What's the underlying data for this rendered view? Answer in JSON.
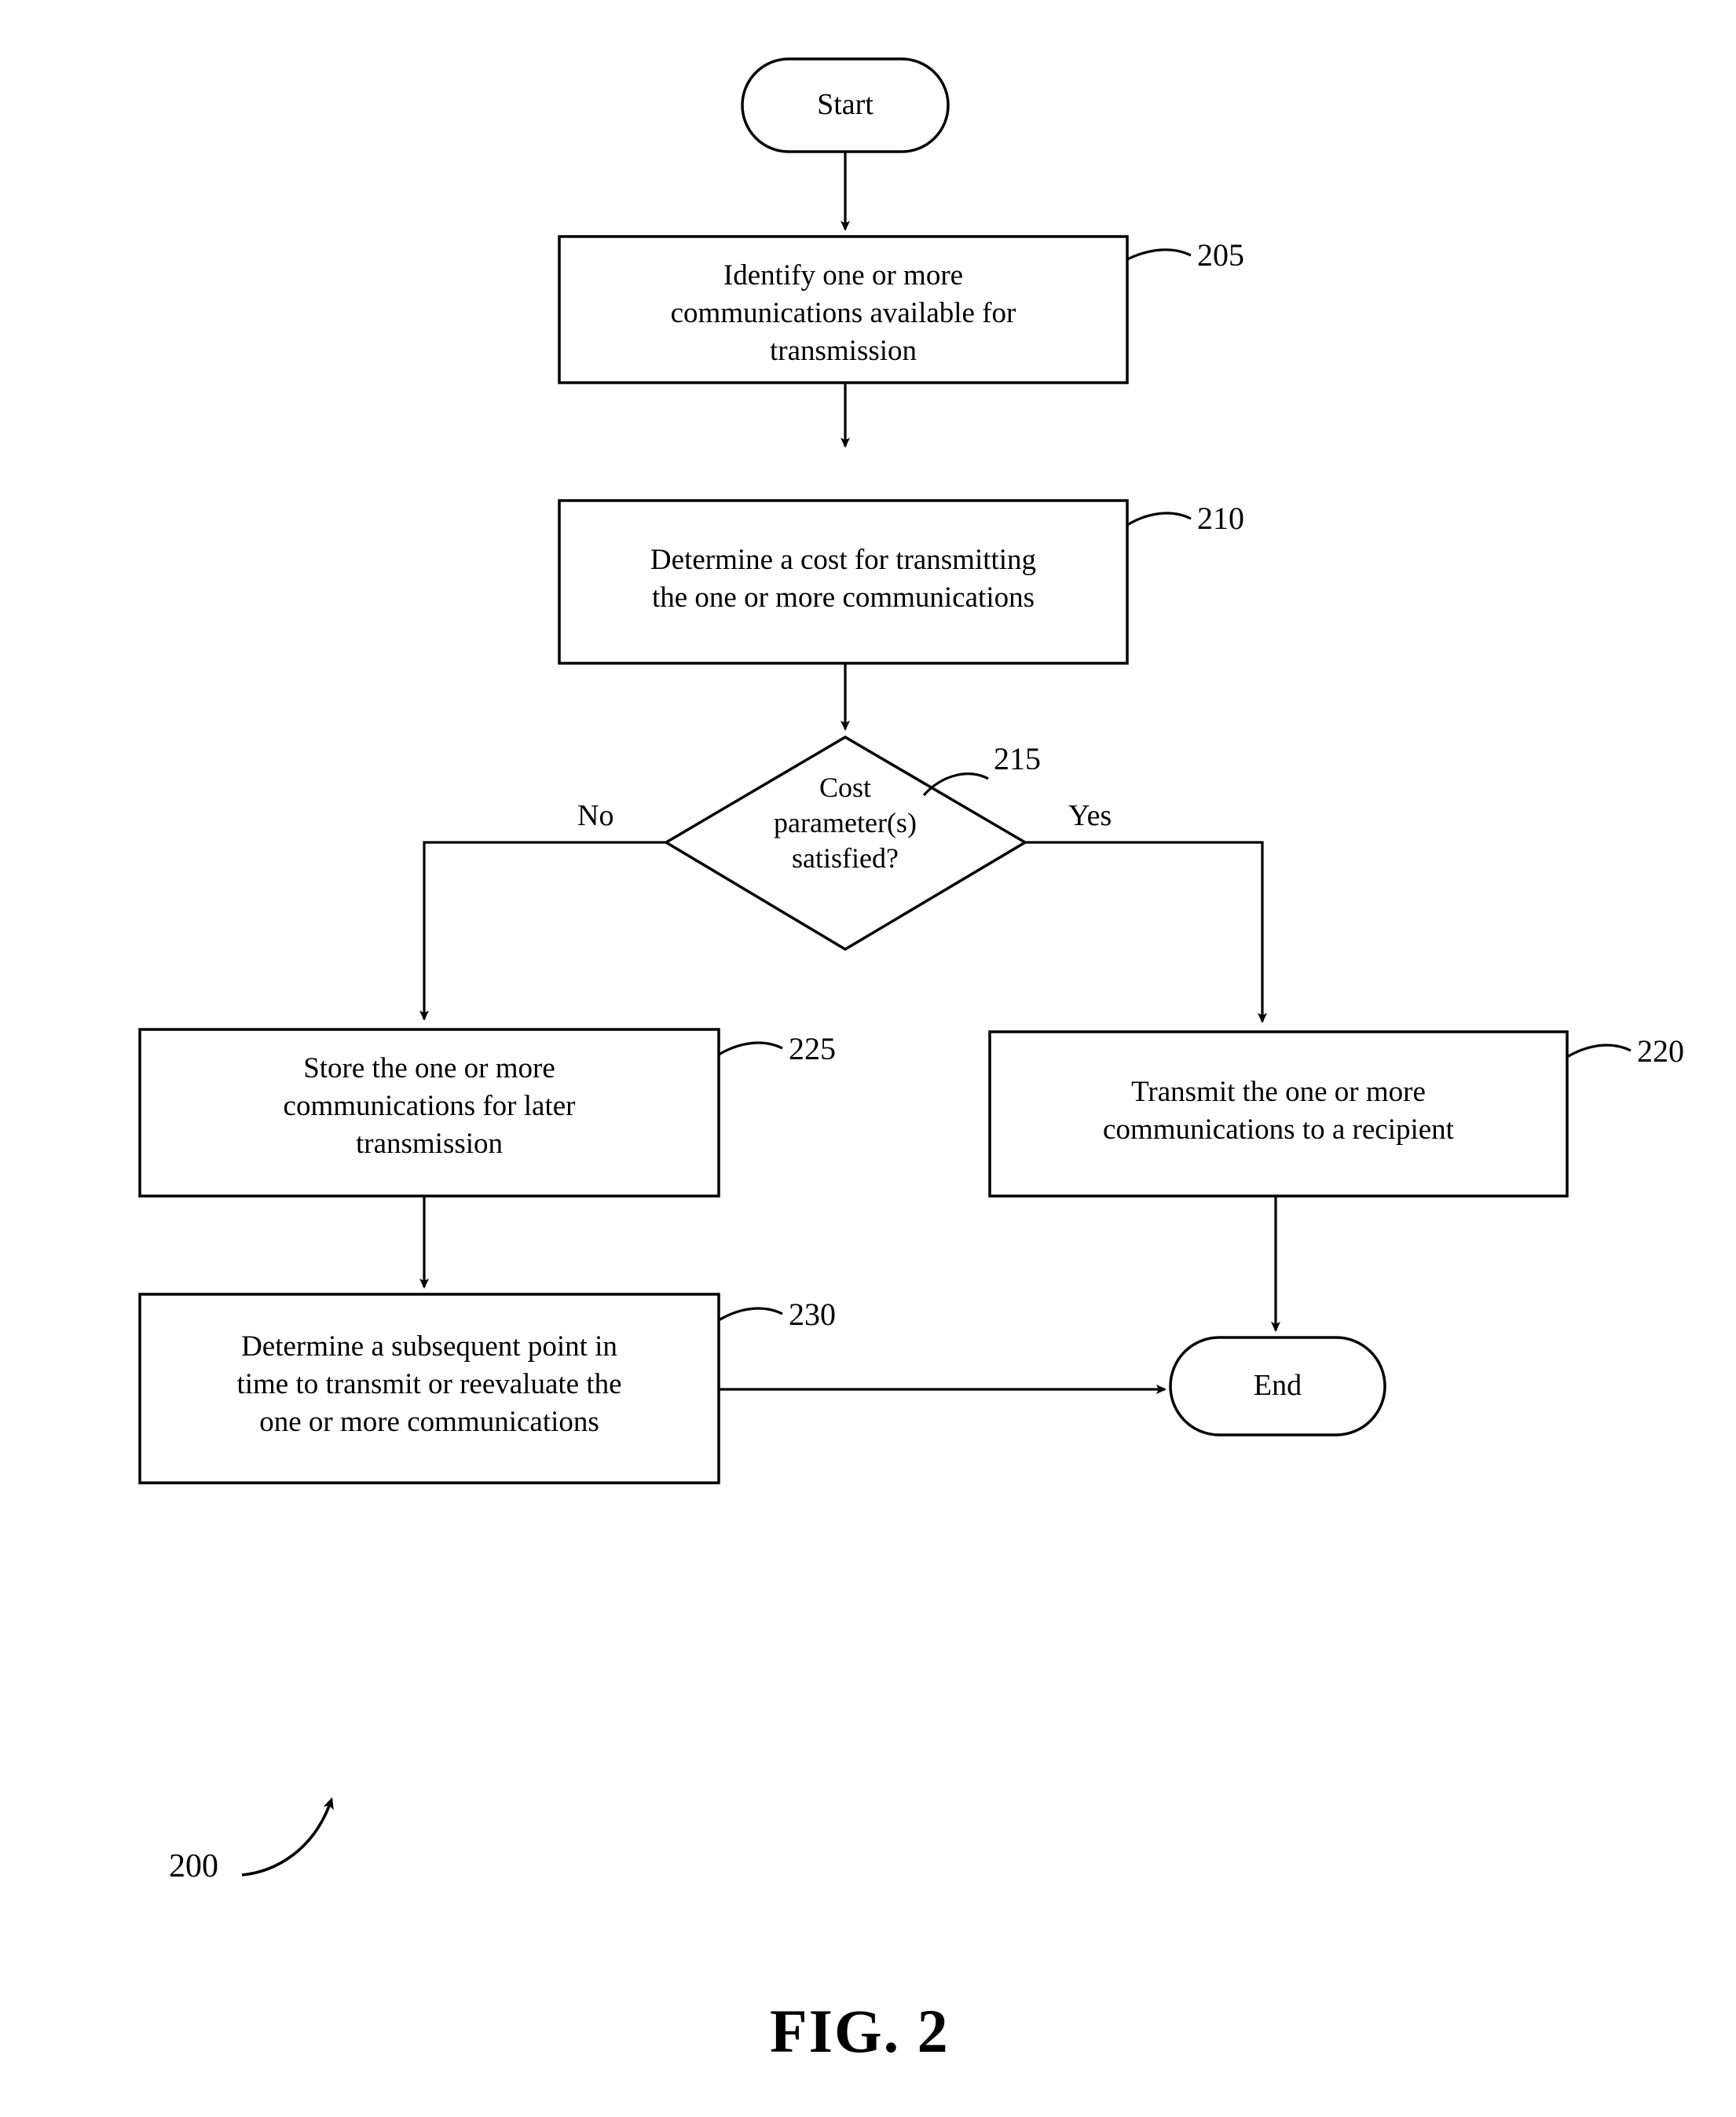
{
  "figure": {
    "caption": "FIG. 2",
    "diagram_reference": "200",
    "type": "flowchart"
  },
  "nodes": {
    "start": {
      "label": "Start",
      "shape": "terminator"
    },
    "step_205": {
      "ref": "205",
      "label": "Identify one or more\ncommunications available for\ntransmission",
      "shape": "process"
    },
    "step_210": {
      "ref": "210",
      "label": "Determine a cost for transmitting\nthe one or more communications",
      "shape": "process"
    },
    "decision_215": {
      "ref": "215",
      "label": "Cost\nparameter(s)\nsatisfied?",
      "shape": "decision"
    },
    "step_220": {
      "ref": "220",
      "label": "Transmit the one or more\ncommunications to a recipient",
      "shape": "process"
    },
    "step_225": {
      "ref": "225",
      "label": "Store the one or more\ncommunications for later\ntransmission",
      "shape": "process"
    },
    "step_230": {
      "ref": "230",
      "label": "Determine a subsequent point in\ntime to transmit or reevaluate the\none or more communications",
      "shape": "process"
    },
    "end": {
      "label": "End",
      "shape": "terminator"
    }
  },
  "branches": {
    "no_label": "No",
    "yes_label": "Yes"
  },
  "colors": {
    "stroke": "#000000",
    "fill": "#ffffff",
    "text": "#000000"
  }
}
